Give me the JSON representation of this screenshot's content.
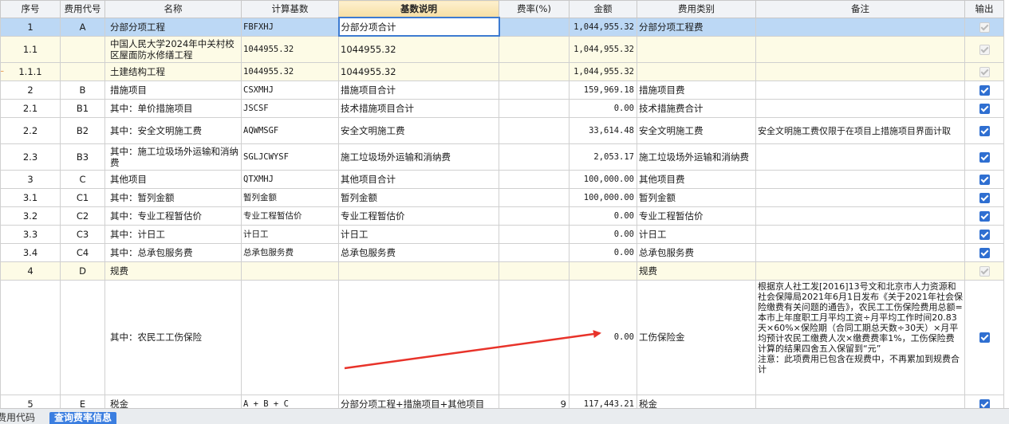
{
  "columns": {
    "seq": "序号",
    "code": "费用代号",
    "name": "名称",
    "basis": "计算基数",
    "desc": "基数说明",
    "rate": "费率(%)",
    "amount": "金额",
    "category": "费用类别",
    "note": "备注",
    "output": "输出"
  },
  "rows": [
    {
      "seq": "1",
      "code": "A",
      "name": "分部分项工程",
      "basis": "FBFXHJ",
      "desc": "分部分项合计",
      "rate": "",
      "amount": "1,044,955.32",
      "category": "分部分项工程费",
      "note": "",
      "output": "disabled"
    },
    {
      "seq": "1.1",
      "code": "",
      "name": "中国人民大学2024年中关村校区屋面防水修缮工程",
      "basis": "1044955.32",
      "desc": "1044955.32",
      "rate": "",
      "amount": "1,044,955.32",
      "category": "",
      "note": "",
      "output": "disabled"
    },
    {
      "seq": "1.1.1",
      "code": "",
      "name": "土建结构工程",
      "basis": "1044955.32",
      "desc": "1044955.32",
      "rate": "",
      "amount": "1,044,955.32",
      "category": "",
      "note": "",
      "output": "disabled"
    },
    {
      "seq": "2",
      "code": "B",
      "name": "措施项目",
      "basis": "CSXMHJ",
      "desc": "措施项目合计",
      "rate": "",
      "amount": "159,969.18",
      "category": "措施项目费",
      "note": "",
      "output": "checked"
    },
    {
      "seq": "2.1",
      "code": "B1",
      "name": "其中：单价措施项目",
      "basis": "JSCSF",
      "desc": "技术措施项目合计",
      "rate": "",
      "amount": "0.00",
      "category": "技术措施费合计",
      "note": "",
      "output": "checked"
    },
    {
      "seq": "2.2",
      "code": "B2",
      "name": "其中：安全文明施工费",
      "basis": "AQWMSGF",
      "desc": "安全文明施工费",
      "rate": "",
      "amount": "33,614.48",
      "category": "安全文明施工费",
      "note": "安全文明施工费仅限于在项目上措施项目界面计取",
      "output": "checked"
    },
    {
      "seq": "2.3",
      "code": "B3",
      "name": "其中：施工垃圾场外运输和消纳费",
      "basis": "SGLJCWYSF",
      "desc": "施工垃圾场外运输和消纳费",
      "rate": "",
      "amount": "2,053.17",
      "category": "施工垃圾场外运输和消纳费",
      "note": "",
      "output": "checked"
    },
    {
      "seq": "3",
      "code": "C",
      "name": "其他项目",
      "basis": "QTXMHJ",
      "desc": "其他项目合计",
      "rate": "",
      "amount": "100,000.00",
      "category": "其他项目费",
      "note": "",
      "output": "checked"
    },
    {
      "seq": "3.1",
      "code": "C1",
      "name": "其中：暂列金额",
      "basis": "暂列金额",
      "desc": "暂列金额",
      "rate": "",
      "amount": "100,000.00",
      "category": "暂列金额",
      "note": "",
      "output": "checked"
    },
    {
      "seq": "3.2",
      "code": "C2",
      "name": "其中：专业工程暂估价",
      "basis": "专业工程暂估价",
      "desc": "专业工程暂估价",
      "rate": "",
      "amount": "0.00",
      "category": "专业工程暂估价",
      "note": "",
      "output": "checked"
    },
    {
      "seq": "3.3",
      "code": "C3",
      "name": "其中：计日工",
      "basis": "计日工",
      "desc": "计日工",
      "rate": "",
      "amount": "0.00",
      "category": "计日工",
      "note": "",
      "output": "checked"
    },
    {
      "seq": "3.4",
      "code": "C4",
      "name": "其中：总承包服务费",
      "basis": "总承包服务费",
      "desc": "总承包服务费",
      "rate": "",
      "amount": "0.00",
      "category": "总承包服务费",
      "note": "",
      "output": "checked"
    },
    {
      "seq": "4",
      "code": "D",
      "name": "规费",
      "basis": "",
      "desc": "",
      "rate": "",
      "amount": "",
      "category": "规费",
      "note": "",
      "output": "disabled"
    },
    {
      "seq": "",
      "code": "",
      "name": "其中：农民工工伤保险",
      "basis": "",
      "desc": "",
      "rate": "",
      "amount": "0.00",
      "category": "工伤保险金",
      "note": "根据京人社工发[2016]13号文和北京市人力资源和社会保障局2021年6月1日发布《关于2021年社会保险缴费有关问题的通告》，农民工工伤保险费用总额=本市上年度职工月平均工资÷月平均工作时间20.83天×60%×保险期（合同工期总天数÷30天）×月平均预计农民工缴费人次×缴费费率1%，工伤保险费计算的结果四舍五入保留到“元”\n注意：此项费用已包含在规费中，不再累加到规费合计",
      "output": "checked"
    },
    {
      "seq": "5",
      "code": "E",
      "name": "税金",
      "basis": "A + B + C",
      "desc": "分部分项工程+措施项目+其他项目",
      "rate": "9",
      "amount": "117,443.21",
      "category": "税金",
      "note": "",
      "output": "checked"
    }
  ],
  "bottom_tabs": [
    "费用代码",
    "查询费率信息"
  ],
  "colors": {
    "selected_row": "#bcd8f5",
    "yellow_row": "#fdfbe6",
    "checkbox": "#2f6fd1",
    "arrow": "#e8332a",
    "active_tab": "#3b7ee0"
  },
  "icons": [
    "checkbox-checked-icon",
    "checkbox-disabled-icon",
    "red-arrow-annotation"
  ]
}
